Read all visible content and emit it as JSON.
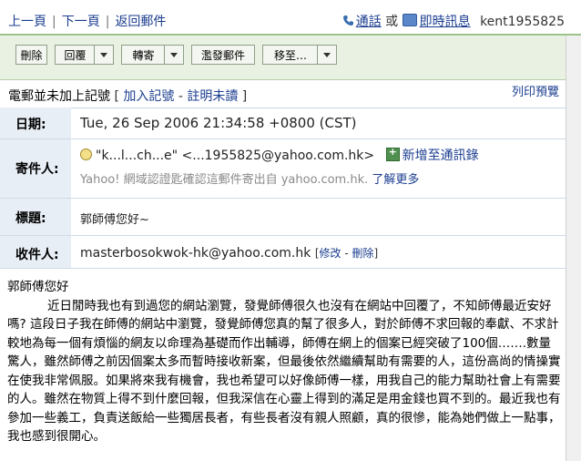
{
  "nav": {
    "prev": "上一頁",
    "next": "下一頁",
    "back": "返回郵件",
    "call": "通話",
    "or": "或",
    "im": "即時訊息",
    "user": "kent1955825"
  },
  "toolbar": {
    "delete": "刪除",
    "reply": "回覆",
    "forward": "轉寄",
    "spam": "濫發郵件",
    "move": "移至…"
  },
  "info": {
    "not_tagged": "電郵並未加上記號",
    "add_tag": "加入記號",
    "mark_unread": "註明未讀",
    "print": "列印預覽"
  },
  "headers": {
    "date_label": "日期:",
    "date_value": "Tue, 26 Sep 2006 21:34:58 +0800 (CST)",
    "from_label": "寄件人:",
    "from_value": "\"k...l...ch...e\" <...1955825@yahoo.com.hk>",
    "add_contact": "新增至通訊錄",
    "verified_text": "Yahoo! 網域認證匙確認這郵件寄出自 yahoo.com.hk.",
    "learn_more": "了解更多",
    "subject_label": "標題:",
    "subject_value": "郭師傅您好~",
    "to_label": "收件人:",
    "to_value": "masterbosokwok-hk@yahoo.com.hk",
    "edit": "修改",
    "delete_link": "刪除"
  },
  "body": {
    "greeting": "郭師傅您好",
    "paragraph": "近日閒時我也有到過您的網站瀏覽，發覺師傅很久也沒有在網站中回覆了，不知師傅最近安好嗎? 這段日子我在師傅的網站中瀏覽，發覺師傅您真的幫了很多人，對於師傅不求回報的奉獻、不求計較地為每一個有煩惱的網友以命理為基礎而作出輔導，師傅在網上的個案已經突破了100個…….數量驚人，雖然師傅之前因個案太多而暫時接收新案，但最後依然繼續幫助有需要的人，這份高尚的情操實在使我非常佩服。如果將來我有機會，我也希望可以好像師傅一樣，用我自己的能力幫助社會上有需要的人。雖然在物質上得不到什麼回報，但我深信在心靈上得到的滿足是用金錢也買不到的。最近我也有參加一些義工，負責送飯給一些獨居長者，有些長者沒有親人照顧，真的很慘，能為她們做上一點事，我也感到很開心。"
  },
  "colors": {
    "link": "#1a3d8f",
    "toolbar_bg": "#e9f1e2",
    "label_bg": "#e8eef5"
  }
}
